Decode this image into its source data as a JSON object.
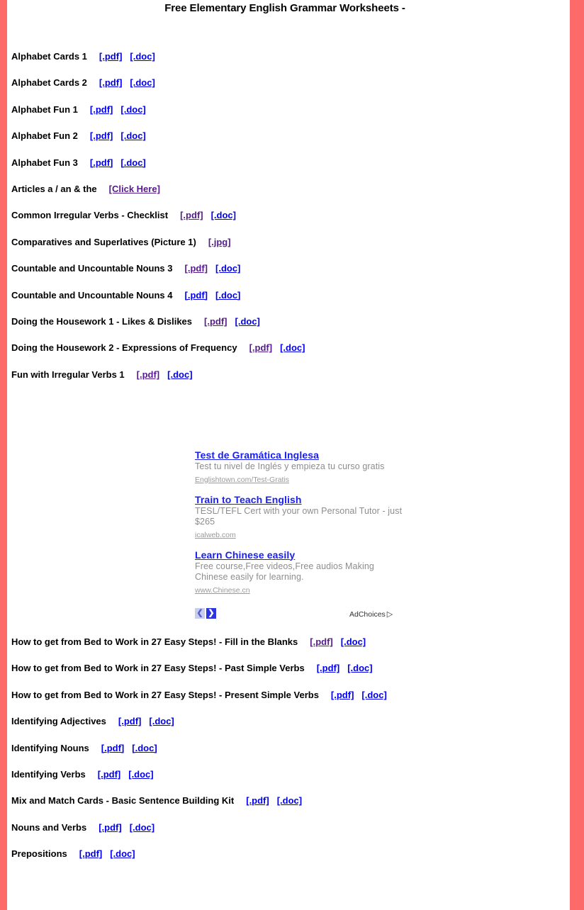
{
  "page": {
    "title": "Free Elementary English Grammar Worksheets -",
    "border_color": "#fc6a6a",
    "background": "#ffffff",
    "link_blue": "#0000ee",
    "link_visited_purple": "#551a8b"
  },
  "worksheets_top": [
    {
      "title": "Alphabet Cards 1",
      "links": [
        {
          "label": "[.pdf]",
          "color": "blue"
        },
        {
          "label": "[.doc]",
          "color": "blue"
        }
      ]
    },
    {
      "title": "Alphabet Cards 2",
      "links": [
        {
          "label": "[.pdf]",
          "color": "blue"
        },
        {
          "label": "[.doc]",
          "color": "blue"
        }
      ]
    },
    {
      "title": "Alphabet Fun 1",
      "links": [
        {
          "label": "[.pdf]",
          "color": "blue"
        },
        {
          "label": "[.doc]",
          "color": "blue"
        }
      ]
    },
    {
      "title": "Alphabet Fun 2",
      "links": [
        {
          "label": "[.pdf]",
          "color": "blue"
        },
        {
          "label": "[.doc]",
          "color": "blue"
        }
      ]
    },
    {
      "title": "Alphabet Fun 3",
      "links": [
        {
          "label": "[.pdf]",
          "color": "blue"
        },
        {
          "label": "[.doc]",
          "color": "blue"
        }
      ]
    },
    {
      "title": "Articles a / an & the",
      "links": [
        {
          "label": "[Click Here]",
          "color": "purple"
        }
      ]
    },
    {
      "title": "Common Irregular Verbs - Checklist",
      "links": [
        {
          "label": "[.pdf]",
          "color": "purple"
        },
        {
          "label": "[.doc]",
          "color": "blue"
        }
      ]
    },
    {
      "title": "Comparatives and Superlatives (Picture 1)",
      "links": [
        {
          "label": "[.jpg]",
          "color": "purple"
        }
      ]
    },
    {
      "title": "Countable and Uncountable Nouns 3",
      "links": [
        {
          "label": "[.pdf]",
          "color": "purple"
        },
        {
          "label": "[.doc]",
          "color": "blue"
        }
      ]
    },
    {
      "title": "Countable and Uncountable Nouns 4",
      "links": [
        {
          "label": "[.pdf]",
          "color": "blue"
        },
        {
          "label": "[.doc]",
          "color": "blue"
        }
      ]
    },
    {
      "title": "Doing the Housework 1 - Likes & Dislikes",
      "links": [
        {
          "label": "[.pdf]",
          "color": "purple"
        },
        {
          "label": "[.doc]",
          "color": "blue"
        }
      ]
    },
    {
      "title": "Doing the Housework 2 - Expressions of Frequency",
      "links": [
        {
          "label": "[.pdf]",
          "color": "purple"
        },
        {
          "label": "[.doc]",
          "color": "blue"
        }
      ]
    },
    {
      "title": "Fun with Irregular Verbs 1",
      "links": [
        {
          "label": "[.pdf]",
          "color": "purple"
        },
        {
          "label": "[.doc]",
          "color": "blue"
        }
      ]
    }
  ],
  "ads": {
    "items": [
      {
        "headline": "Test de Gramática Inglesa",
        "description": "Test tu nivel de Inglés y empieza tu curso gratis",
        "url": "Englishtown.com/Test-Gratis"
      },
      {
        "headline": "Train to Teach English",
        "description": "TESL/TEFL Cert with your own Personal Tutor - just $265",
        "url": "icalweb.com"
      },
      {
        "headline": "Learn Chinese easily",
        "description": "Free course,Free videos,Free audios Making Chinese easily for learning.",
        "url": "www.Chinese.cn"
      }
    ],
    "prev_label": "❮",
    "next_label": "❯",
    "adchoices_label": "AdChoices",
    "adchoices_triangle": "▷"
  },
  "worksheets_bottom": [
    {
      "title": "How to get from Bed to Work in 27 Easy Steps! - Fill in the Blanks",
      "wrap": false,
      "links": [
        {
          "label": "[.pdf]",
          "color": "purple"
        },
        {
          "label": "[.doc]",
          "color": "blue"
        }
      ]
    },
    {
      "title": "How to get from Bed to Work in 27 Easy Steps! - Past Simple Verbs",
      "wrap": true,
      "links": [
        {
          "label": "[.pdf]",
          "color": "blue"
        },
        {
          "label": "[.doc]",
          "color": "blue"
        }
      ]
    },
    {
      "title": "How to get from Bed to Work in 27 Easy Steps! - Present Simple Verbs",
      "wrap": true,
      "links": [
        {
          "label": "[.pdf]",
          "color": "blue"
        },
        {
          "label": "[.doc]",
          "color": "blue"
        }
      ]
    },
    {
      "title": "Identifying Adjectives",
      "wrap": false,
      "links": [
        {
          "label": "[.pdf]",
          "color": "blue"
        },
        {
          "label": "[.doc]",
          "color": "blue"
        }
      ]
    },
    {
      "title": "Identifying Nouns",
      "wrap": false,
      "links": [
        {
          "label": "[.pdf]",
          "color": "blue"
        },
        {
          "label": "[.doc]",
          "color": "blue"
        }
      ]
    },
    {
      "title": "Identifying Verbs",
      "wrap": false,
      "links": [
        {
          "label": "[.pdf]",
          "color": "blue"
        },
        {
          "label": "[.doc]",
          "color": "blue"
        }
      ]
    },
    {
      "title": "Mix and Match Cards - Basic Sentence Building Kit",
      "wrap": false,
      "links": [
        {
          "label": "[.pdf]",
          "color": "blue"
        },
        {
          "label": "[.doc]",
          "color": "blue"
        }
      ]
    },
    {
      "title": "Nouns and Verbs",
      "wrap": false,
      "links": [
        {
          "label": "[.pdf]",
          "color": "blue"
        },
        {
          "label": "[.doc]",
          "color": "blue"
        }
      ]
    },
    {
      "title": "Prepositions",
      "wrap": false,
      "links": [
        {
          "label": "[.pdf]",
          "color": "blue"
        },
        {
          "label": "[.doc]",
          "color": "blue"
        }
      ]
    }
  ]
}
